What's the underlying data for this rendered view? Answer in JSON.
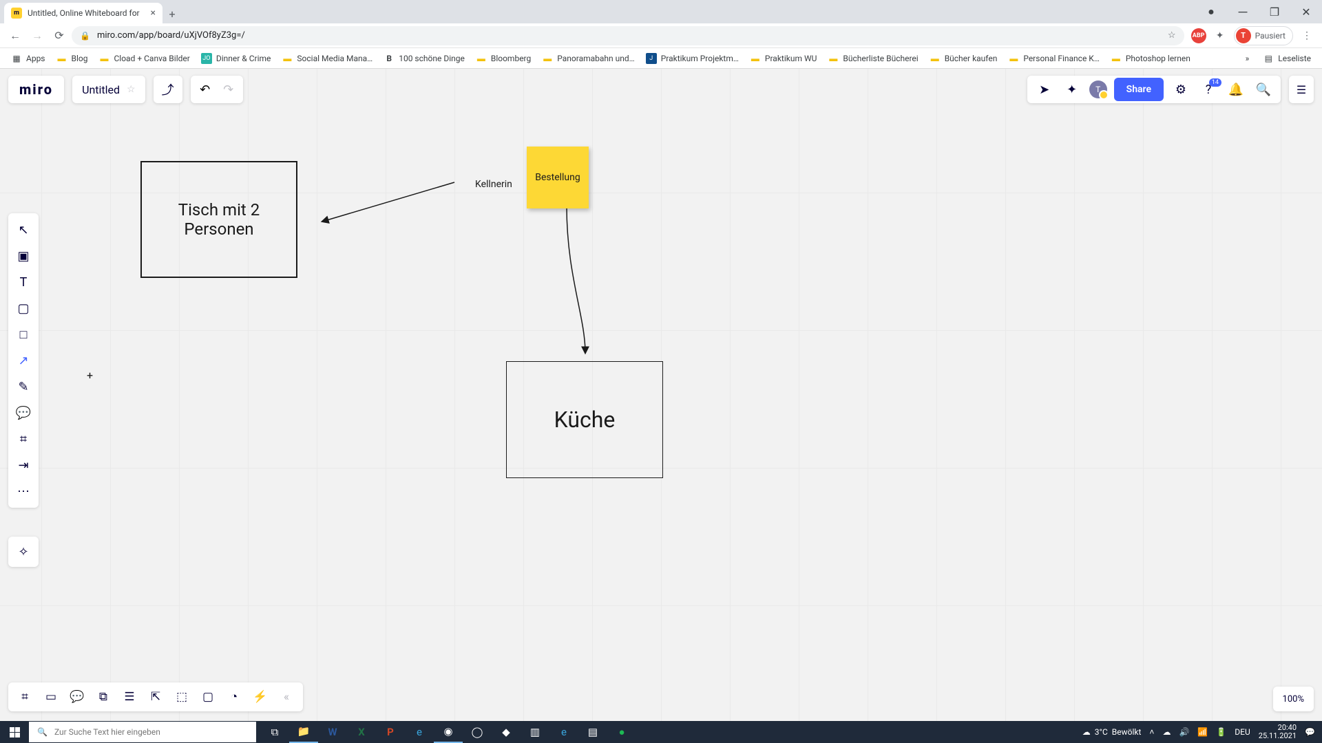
{
  "browser": {
    "tab_title": "Untitled, Online Whiteboard for",
    "url": "miro.com/app/board/uXjVOf8yZ3g=/",
    "profile_state": "Pausiert",
    "profile_initial": "T"
  },
  "bookmarks": {
    "apps": "Apps",
    "items": [
      "Blog",
      "Cload + Canva Bilder",
      "Dinner & Crime",
      "Social Media Mana…",
      "100 schöne Dinge",
      "Bloomberg",
      "Panoramabahn und…",
      "Praktikum Projektm…",
      "Praktikum WU",
      "Bücherliste Bücherei",
      "Bücher kaufen",
      "Personal Finance K…",
      "Photoshop lernen"
    ],
    "overflow": "»",
    "readlist": "Leseliste"
  },
  "miro": {
    "logo": "miro",
    "board_title": "Untitled",
    "share": "Share",
    "notif_count": "14",
    "zoom": "100%"
  },
  "canvas": {
    "box1_line1": "Tisch mit 2",
    "box1_line2": "Personen",
    "label1": "Kellnerin",
    "sticky1": "Bestellung",
    "box2": "Küche"
  },
  "taskbar": {
    "search_placeholder": "Zur Suche Text hier eingeben",
    "weather_temp": "3°C",
    "weather_cond": "Bewölkt",
    "lang": "DEU",
    "time": "20:40",
    "date": "25.11.2021"
  }
}
